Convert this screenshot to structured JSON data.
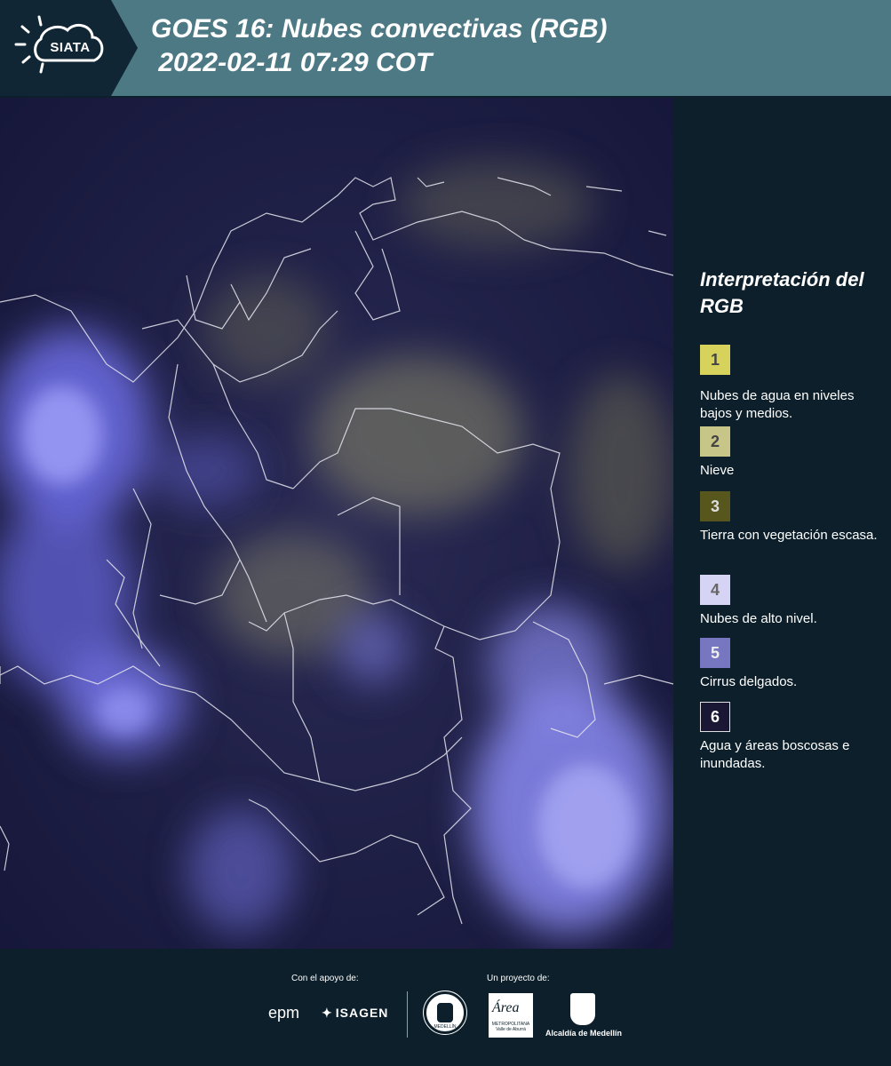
{
  "header": {
    "logo_text": "SIATA",
    "title": "GOES 16: Nubes convectivas (RGB)\n 2022-02-11 07:29 COT"
  },
  "legend": {
    "title": "Interpretación del RGB",
    "items": [
      {
        "number": "1",
        "label": "Nubes de agua en niveles bajos y medios.",
        "color": "#d6d25c",
        "text_color": "#444"
      },
      {
        "number": "2",
        "label": "Nieve",
        "color": "#c7c588",
        "text_color": "#444"
      },
      {
        "number": "3",
        "label": "Tierra con vegetación escasa.",
        "color": "#56561d",
        "text_color": "#ddd"
      },
      {
        "number": "4",
        "label": "Nubes de alto nivel.",
        "color": "#d6d4f4",
        "text_color": "#666"
      },
      {
        "number": "5",
        "label": "Cirrus delgados.",
        "color": "#7776c0",
        "text_color": "#eee"
      },
      {
        "number": "6",
        "label": "Agua y áreas boscosas e inundadas.",
        "color": "#1a1735",
        "text_color": "#fff"
      }
    ]
  },
  "footer": {
    "support_label": "Con el apoyo de:",
    "project_label": "Un proyecto de:",
    "sponsor1": "epm",
    "sponsor2": "ISAGEN",
    "partner_area": "Área",
    "partner_area_sub": "METROPOLITANA Valle de Aburrá",
    "partner_alcaldia": "Alcaldía de Medellín",
    "seal_text": "MEDELLÍN"
  },
  "colors": {
    "header_bg": "#4d7985",
    "page_bg": "#0c1f2a",
    "map_base": "#1d1d45",
    "cloud_blue": "#7f7fff"
  }
}
